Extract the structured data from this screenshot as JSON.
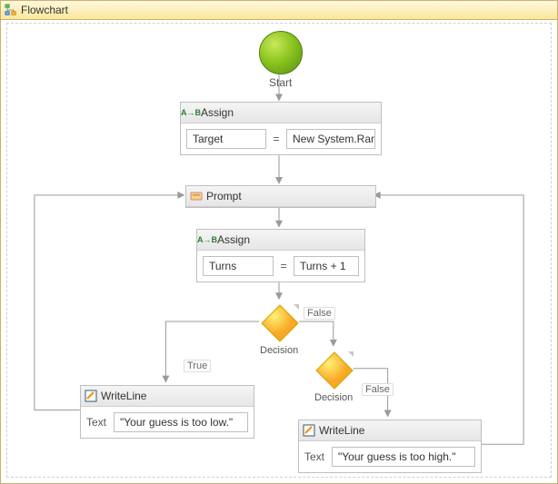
{
  "title": "Flowchart",
  "start_label": "Start",
  "assign1": {
    "header": "Assign",
    "left": "Target",
    "right": "New System.Randc"
  },
  "prompt_label": "Prompt",
  "assign2": {
    "header": "Assign",
    "left": "Turns",
    "right": "Turns + 1"
  },
  "decision1": {
    "label": "Decision",
    "true_label": "True",
    "false_label": "False"
  },
  "decision2": {
    "label": "Decision",
    "false_label": "False"
  },
  "write_low": {
    "header": "WriteLine",
    "prop": "Text",
    "value": "\"Your guess is too low.\""
  },
  "write_high": {
    "header": "WriteLine",
    "prop": "Text",
    "value": "\"Your guess is too high.\""
  }
}
